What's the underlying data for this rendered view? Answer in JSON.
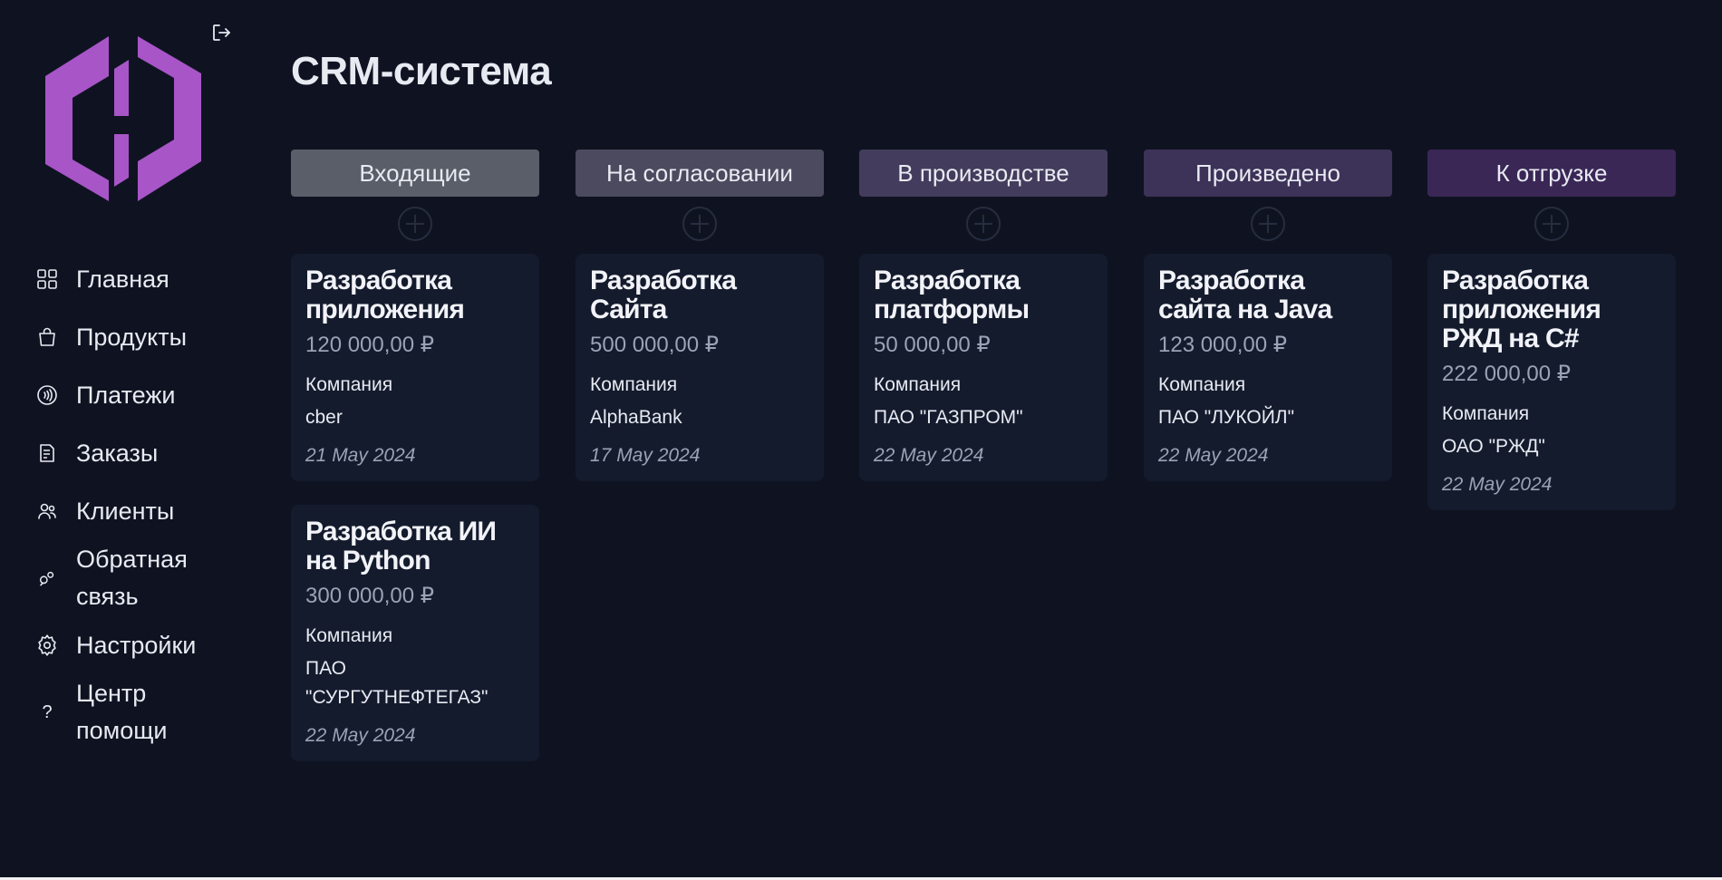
{
  "app": {
    "title": "CRM-система"
  },
  "sidebar": {
    "logo_icon": "hashicorp-logo-icon",
    "logout_icon": "logout-icon",
    "items": [
      {
        "label": "Главная",
        "icon": "grid-icon"
      },
      {
        "label": "Продукты",
        "icon": "shopping-bag-icon"
      },
      {
        "label": "Платежи",
        "icon": "contactless-payment-icon"
      },
      {
        "label": "Заказы",
        "icon": "document-icon"
      },
      {
        "label": "Клиенты",
        "icon": "users-icon"
      },
      {
        "label": "Обратная связь",
        "icon": "feedback-icon"
      },
      {
        "label": "Настройки",
        "icon": "gear-icon"
      },
      {
        "label": "Центр помощи",
        "icon": "question-icon"
      }
    ]
  },
  "columns": [
    {
      "title": "Входящие",
      "color": "#595e69",
      "cards": [
        {
          "title": "Разработка приложения",
          "amount": "120 000,00 ₽",
          "company_label": "Компания",
          "company": "cber",
          "date": "21 May 2024"
        },
        {
          "title": "Разработка ИИ на Python",
          "amount": "300 000,00 ₽",
          "company_label": "Компания",
          "company": "ПАО \"СУРГУТНЕФТЕГАЗ\"",
          "date": "22 May 2024"
        }
      ]
    },
    {
      "title": "На согласовании",
      "color": "#4b4a5e",
      "cards": [
        {
          "title": "Разработка Сайта",
          "amount": "500 000,00 ₽",
          "company_label": "Компания",
          "company": "AlphaBank",
          "date": "17 May 2024"
        }
      ]
    },
    {
      "title": "В производстве",
      "color": "#443c5c",
      "cards": [
        {
          "title": "Разработка платформы",
          "amount": "50 000,00 ₽",
          "company_label": "Компания",
          "company": "ПАО \"ГАЗПРОМ\"",
          "date": "22 May 2024"
        }
      ]
    },
    {
      "title": "Произведено",
      "color": "#3d3258",
      "cards": [
        {
          "title": "Разработка сайта на Java",
          "amount": "123 000,00 ₽",
          "company_label": "Компания",
          "company": "ПАО \"ЛУКОЙЛ\"",
          "date": "22 May 2024"
        }
      ]
    },
    {
      "title": "К отгрузке",
      "color": "#3a2756",
      "cards": [
        {
          "title": "Разработка приложения РЖД на C#",
          "amount": "222 000,00 ₽",
          "company_label": "Компания",
          "company": "ОАО \"РЖД\"",
          "date": "22 May 2024"
        }
      ]
    }
  ],
  "colors": {
    "background": "#0f1321",
    "card": "#141b2d",
    "accent": "#a855c8"
  }
}
